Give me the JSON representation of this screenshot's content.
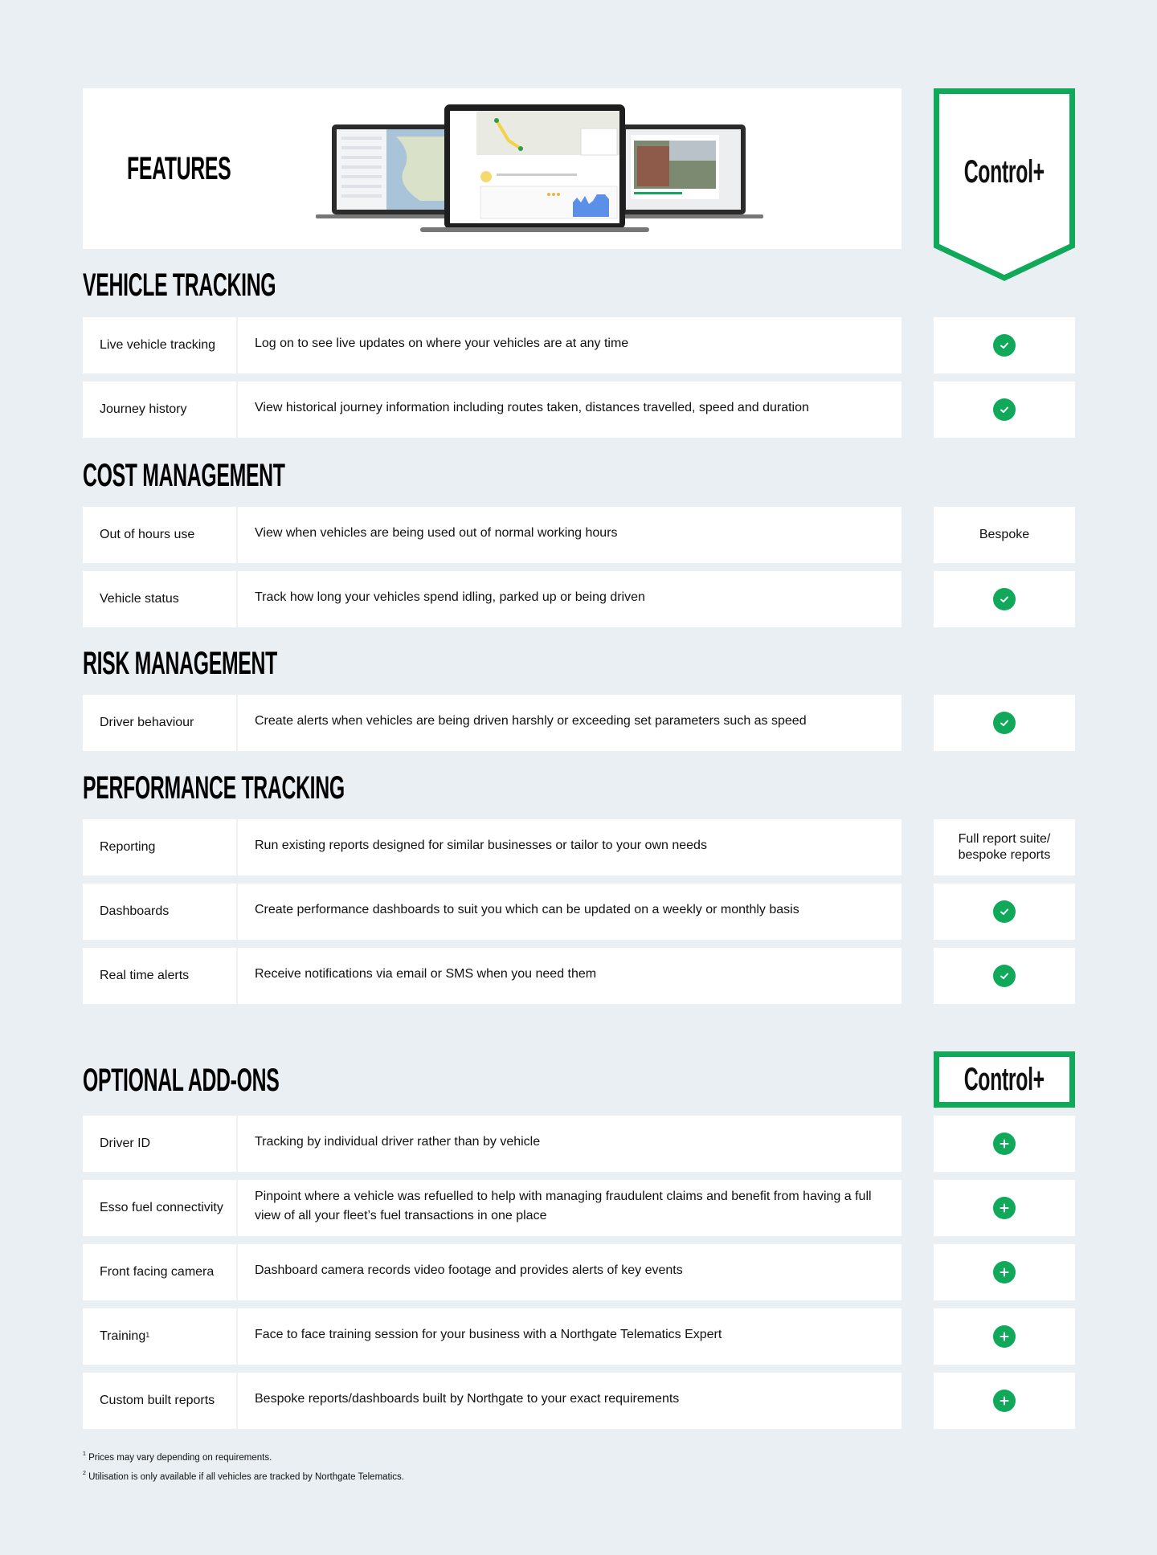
{
  "header": {
    "features_title": "Features",
    "plan_name": "Control+",
    "image_alt": "laptops-showing-telematics-dashboard"
  },
  "colors": {
    "accent": "#10a95a",
    "background": "#e9eff3",
    "row": "#ffffff"
  },
  "sections": [
    {
      "title": "Vehicle Tracking",
      "rows": [
        {
          "name": "Live vehicle tracking",
          "desc": "Log on to see live updates on where your vehicles are at any time",
          "value": "check"
        },
        {
          "name": "Journey history",
          "desc": "View historical journey information including routes taken, distances travelled, speed and duration",
          "value": "check"
        }
      ]
    },
    {
      "title": "Cost Management",
      "rows": [
        {
          "name": "Out of hours use",
          "desc": "View when vehicles are being used out of normal working hours",
          "value": "Bespoke"
        },
        {
          "name": "Vehicle status",
          "desc": "Track how long your vehicles spend idling, parked up or being driven",
          "value": "check"
        }
      ]
    },
    {
      "title": "Risk Management",
      "rows": [
        {
          "name": "Driver behaviour",
          "desc": "Create alerts when vehicles are being driven harshly or exceeding set parameters such as speed",
          "value": "check"
        }
      ]
    },
    {
      "title": "Performance Tracking",
      "rows": [
        {
          "name": "Reporting",
          "desc": "Run existing reports designed for similar businesses or tailor to your own needs",
          "value": "Full report suite/ bespoke reports"
        },
        {
          "name": "Dashboards",
          "desc": "Create performance dashboards to suit you which can be updated on a weekly or monthly basis",
          "value": "check"
        },
        {
          "name": "Real time alerts",
          "desc": "Receive notifications via email or SMS when you need them",
          "value": "check"
        }
      ]
    }
  ],
  "addons": {
    "title": "Optional Add-ons",
    "plan_name": "Control+",
    "rows": [
      {
        "name": "Driver ID",
        "sup": "",
        "desc": "Tracking by individual driver rather than by vehicle",
        "value": "plus"
      },
      {
        "name": "Esso fuel connectivity",
        "sup": "",
        "desc": "Pinpoint where a vehicle was refuelled to help with managing fraudulent claims and benefit from having a full view of all your fleet’s fuel transactions in one place",
        "value": "plus"
      },
      {
        "name": "Front facing camera",
        "sup": "",
        "desc": "Dashboard camera records video footage and provides alerts of key events",
        "value": "plus"
      },
      {
        "name": "Training",
        "sup": "1",
        "desc": "Face to face training session for your business with a Northgate Telematics Expert",
        "value": "plus"
      },
      {
        "name": "Custom built reports",
        "sup": "",
        "desc": "Bespoke reports/dashboards built by Northgate to your exact requirements",
        "value": "plus"
      }
    ]
  },
  "footnotes": [
    {
      "mark": "1",
      "text": "Prices may vary depending on requirements."
    },
    {
      "mark": "2",
      "text": "Utilisation is only available if all vehicles are tracked by Northgate Telematics."
    }
  ]
}
